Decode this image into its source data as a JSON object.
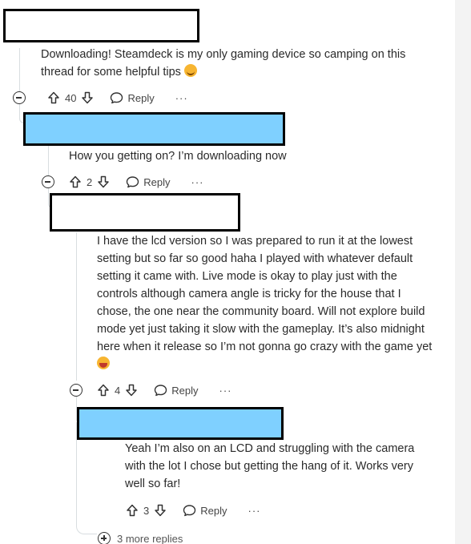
{
  "comments": [
    {
      "body": "Downloading! Steamdeck is my only gaming device so camping on this thread for some helpful tips",
      "votes": "40",
      "reply_label": "Reply",
      "more_label": "···"
    },
    {
      "body": "How you getting on? I’m downloading now",
      "votes": "2",
      "reply_label": "Reply",
      "more_label": "···"
    },
    {
      "body": "I have the lcd version so I was prepared to run it at the lowest setting but so far so good haha I played with whatever default setting it came with. Live mode is okay to play just with the controls although camera angle is tricky for the house that I chose, the one near the community board. Will not explore build mode yet just taking it slow with the gameplay. It’s also midnight here when it release so I’m not gonna go crazy with the game yet",
      "votes": "4",
      "reply_label": "Reply",
      "more_label": "···"
    },
    {
      "body": "Yeah I’m also on an LCD and struggling with the camera with the lot I chose but getting the hang of it. Works very well so far!",
      "votes": "3",
      "reply_label": "Reply",
      "more_label": "···"
    }
  ],
  "more_replies_label": "3 more replies",
  "icons": {
    "collapse": "collapse-icon",
    "upvote": "upvote-icon",
    "downvote": "downvote-icon",
    "reply": "reply-icon",
    "expand": "expand-icon",
    "emoji_smile": "smiling-face-emoji",
    "emoji_laugh": "laughing-face-emoji"
  },
  "colors": {
    "redaction_blue": "#7fd0ff",
    "thread_line": "#d8dde0"
  }
}
